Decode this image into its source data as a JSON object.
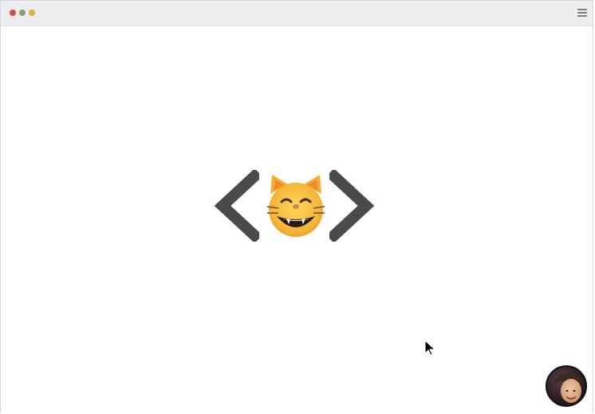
{
  "window": {
    "controls": {
      "close_color": "#d0514a",
      "minimize_color": "#8da06d",
      "zoom_color": "#d6b14a"
    },
    "menu_icon": "hamburger-menu-icon"
  },
  "content": {
    "logo": {
      "left_symbol": "chevron-left",
      "center_emoji": "😸",
      "right_symbol": "chevron-right",
      "chevron_color": "#4a4a4a"
    }
  },
  "overlay": {
    "cursor_icon": "mouse-pointer-icon",
    "avatar_icon": "user-avatar"
  }
}
